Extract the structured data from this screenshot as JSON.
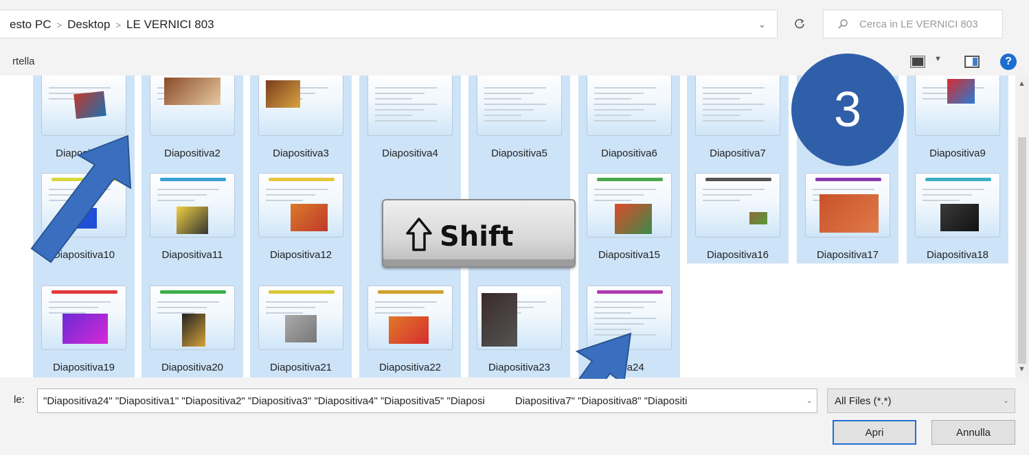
{
  "address": {
    "crumbs": [
      "esto PC",
      "Desktop",
      "LE VERNICI 803"
    ],
    "search_placeholder": "Cerca in LE VERNICI 803"
  },
  "toolbar": {
    "new_folder_label": "rtella"
  },
  "files": [
    {
      "name": "Diapositiva1"
    },
    {
      "name": "Diapositiva2"
    },
    {
      "name": "Diapositiva3"
    },
    {
      "name": "Diapositiva4"
    },
    {
      "name": "Diapositiva5"
    },
    {
      "name": "Diapositiva6"
    },
    {
      "name": "Diapositiva7"
    },
    {
      "name": "Diapositiva9"
    },
    {
      "name": "Diapositiva10"
    },
    {
      "name": "Diapositiva11"
    },
    {
      "name": "Diapositiva12"
    },
    {
      "name": "Diapositiva15"
    },
    {
      "name": "Diapositiva16"
    },
    {
      "name": "Diapositiva17"
    },
    {
      "name": "Diapositiva18"
    },
    {
      "name": "Diapositiva19"
    },
    {
      "name": "Diapositiva20"
    },
    {
      "name": "Diapositiva21"
    },
    {
      "name": "Diapositiva22"
    },
    {
      "name": "Diapositiva23"
    },
    {
      "name": "itiva24"
    }
  ],
  "overlay": {
    "shift_key_label": "Shift",
    "step_number": "3"
  },
  "bottom": {
    "filename_label": "le:",
    "filename_value": "\"Diapositiva24\" \"Diapositiva1\" \"Diapositiva2\" \"Diapositiva3\" \"Diapositiva4\" \"Diapositiva5\" \"Diaposi",
    "filename_value_tail": "Diapositiva7\" \"Diapositiva8\" \"Diapositi",
    "filter_value": "All Files (*.*)",
    "open_label": "Apri",
    "cancel_label": "Annulla"
  },
  "colors": {
    "selection": "#cde3f8",
    "badge": "#2f5fa9",
    "pointer_arrow": "#3a6fc0",
    "accent": "#1f6fcf"
  }
}
